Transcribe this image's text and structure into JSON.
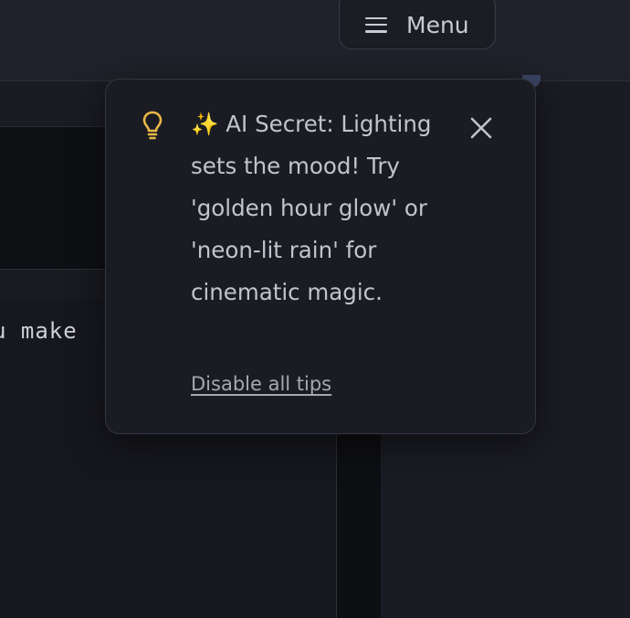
{
  "header": {
    "menu_label": "Menu",
    "menu_icon": "hamburger-icon"
  },
  "editor": {
    "visible_text": "u make"
  },
  "tip": {
    "icon": "lightbulb-icon",
    "icon_color": "#e9b949",
    "message": "✨ AI Secret: Lighting sets the mood! Try 'golden hour glow' or 'neon-lit rain' for cinematic magic.",
    "close_icon": "close-icon",
    "disable_label": "Disable all tips"
  },
  "colors": {
    "background": "#1b1c23",
    "panel": "#0f1014",
    "text": "#c2c3cc",
    "accent_dot": "#3c4566"
  }
}
